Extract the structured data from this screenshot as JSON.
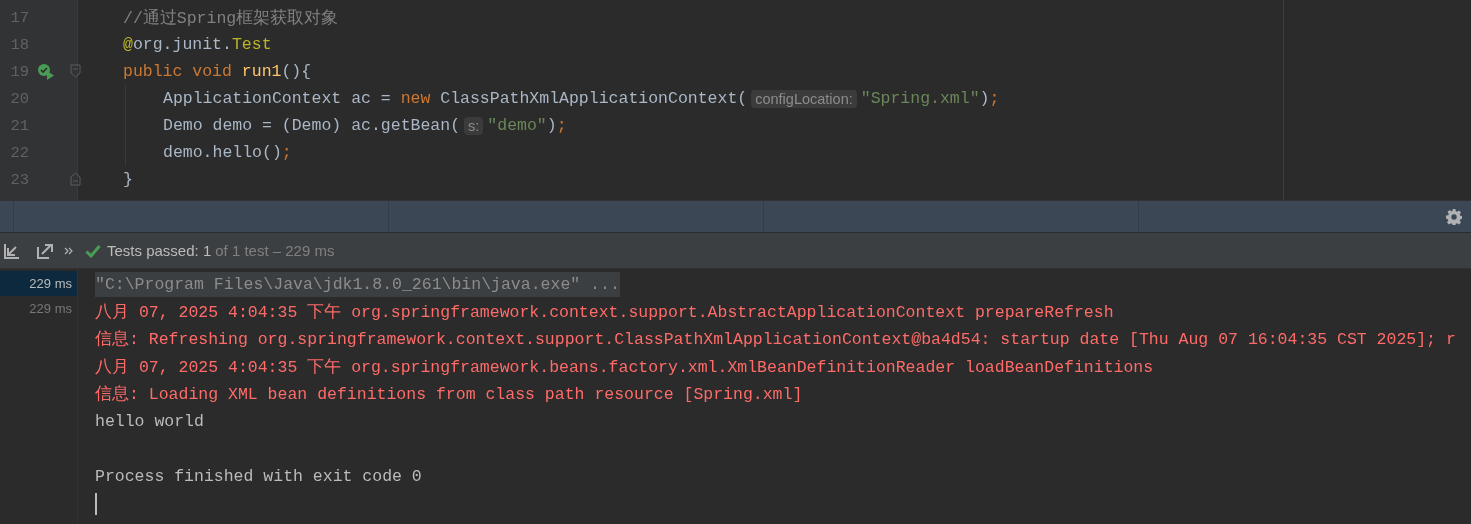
{
  "editor": {
    "lines": [
      {
        "number": "17",
        "tokens": [
          {
            "kind": "comment",
            "text": "//通过Spring框架获取对象"
          }
        ]
      },
      {
        "number": "18",
        "tokens": [
          {
            "kind": "annotation",
            "text": "@"
          },
          {
            "kind": "plain",
            "text": "org.junit."
          },
          {
            "kind": "annotation",
            "text": "Test"
          }
        ]
      },
      {
        "number": "19",
        "gutter_icons": [
          {
            "kind": "run"
          },
          {
            "kind": "fold-start"
          }
        ],
        "tokens": [
          {
            "kind": "keyword",
            "text": "public void "
          },
          {
            "kind": "method",
            "text": "run1"
          },
          {
            "kind": "plain",
            "text": "(){"
          }
        ],
        "children": [
          {
            "number": "20",
            "tokens": [
              {
                "kind": "plain",
                "text": "ApplicationContext ac = "
              },
              {
                "kind": "keyword",
                "text": "new "
              },
              {
                "kind": "plain",
                "text": "ClassPathXmlApplicationContext("
              },
              {
                "kind": "hint",
                "text": "configLocation:"
              },
              {
                "kind": "string",
                "text": "\"Spring.xml\""
              },
              {
                "kind": "plain",
                "text": ")"
              },
              {
                "kind": "keyword",
                "text": ";"
              }
            ]
          },
          {
            "number": "21",
            "tokens": [
              {
                "kind": "plain",
                "text": "Demo demo = (Demo) ac.getBean("
              },
              {
                "kind": "hint",
                "text": "s:"
              },
              {
                "kind": "string",
                "text": "\"demo\""
              },
              {
                "kind": "plain",
                "text": ")"
              },
              {
                "kind": "keyword",
                "text": ";"
              }
            ]
          },
          {
            "number": "22",
            "tokens": [
              {
                "kind": "plain",
                "text": "demo.hello()"
              },
              {
                "kind": "keyword",
                "text": ";"
              }
            ]
          }
        ]
      },
      {
        "number": "23",
        "gutter_icons": [
          {
            "kind": "fold-end"
          }
        ],
        "tokens": [
          {
            "kind": "plain",
            "text": "}"
          }
        ]
      }
    ]
  },
  "test_toolbar": {
    "status_label": "Tests passed: 1",
    "status_detail": "of 1 test – 229 ms"
  },
  "test_tree": [
    {
      "duration": "229 ms",
      "selected": true
    },
    {
      "duration": "229 ms",
      "selected": false
    }
  ],
  "console": {
    "lines": [
      {
        "kind": "command",
        "text": "\"C:\\Program Files\\Java\\jdk1.8.0_261\\bin\\java.exe\" ..."
      },
      {
        "kind": "error",
        "text": "八月 07, 2025 4:04:35 下午 org.springframework.context.support.AbstractApplicationContext prepareRefresh"
      },
      {
        "kind": "error",
        "text": "信息: Refreshing org.springframework.context.support.ClassPathXmlApplicationContext@ba4d54: startup date [Thu Aug 07 16:04:35 CST 2025]; r"
      },
      {
        "kind": "error",
        "text": "八月 07, 2025 4:04:35 下午 org.springframework.beans.factory.xml.XmlBeanDefinitionReader loadBeanDefinitions"
      },
      {
        "kind": "error",
        "text": "信息: Loading XML bean definitions from class path resource [Spring.xml]"
      },
      {
        "kind": "output",
        "text": "hello world"
      },
      {
        "kind": "blank"
      },
      {
        "kind": "output",
        "text": "Process finished with exit code 0"
      },
      {
        "kind": "cursor"
      }
    ]
  }
}
